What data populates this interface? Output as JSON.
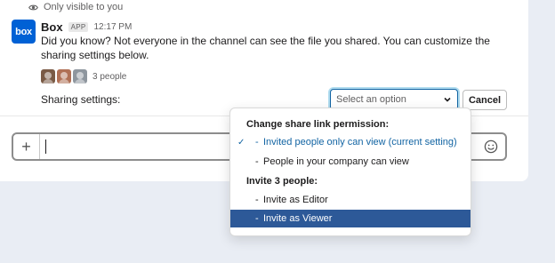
{
  "visibility_note": "Only visible to you",
  "message": {
    "avatar_text": "box",
    "sender": "Box",
    "badge": "APP",
    "time": "12:17 PM",
    "body": "Did you know? Not everyone in the channel can see the file you shared. You can customize the sharing settings below.",
    "people_count": "3 people"
  },
  "sharing": {
    "label": "Sharing settings:",
    "select_placeholder": "Select an option",
    "cancel_label": "Cancel"
  },
  "composer": {
    "plus_label": "+"
  },
  "dropdown": {
    "group1_header": "Change share link permission:",
    "group1_options": [
      "Invited people only can view (current setting)",
      "People in your company can view"
    ],
    "check_mark": "✓",
    "dash": "-",
    "group2_header": "Invite 3 people:",
    "group2_options": [
      "Invite as Editor",
      "Invite as Viewer"
    ]
  },
  "colors": {
    "brand": "#0061d5",
    "accent": "#1264a3",
    "highlight": "#2d5998"
  }
}
